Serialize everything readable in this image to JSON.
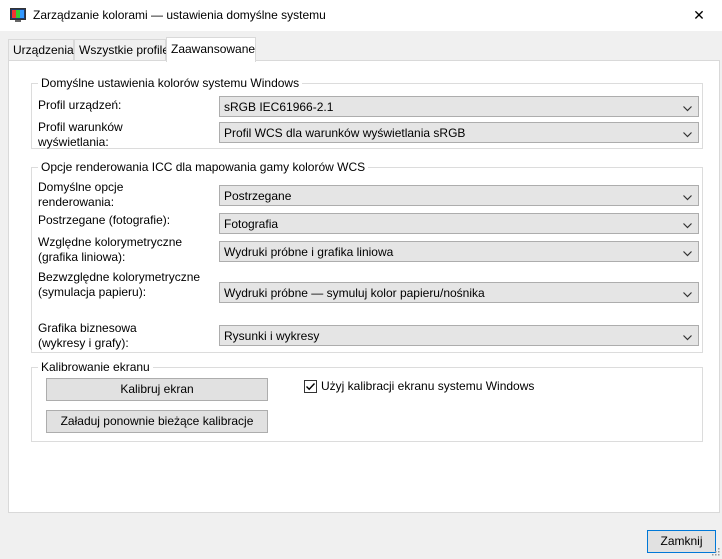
{
  "window": {
    "title": "Zarządzanie kolorami — ustawienia domyślne systemu",
    "close_glyph": "✕",
    "icon": "monitor-color-icon"
  },
  "tabs": [
    {
      "label": "Urządzenia",
      "active": false
    },
    {
      "label": "Wszystkie profile",
      "active": false
    },
    {
      "label": "Zaawansowane",
      "active": true
    }
  ],
  "windows_defaults": {
    "legend": "Domyślne ustawienia kolorów systemu Windows",
    "device_profile_label": "Profil urządzeń:",
    "device_profile_value": "sRGB IEC61966-2.1",
    "viewing_conditions_label": "Profil warunków wyświetlania:",
    "viewing_conditions_value": "Profil WCS dla warunków wyświetlania sRGB"
  },
  "icc_rendering": {
    "legend": "Opcje renderowania ICC dla mapowania gamy kolorów WCS",
    "rows": [
      {
        "label": "Domyślne opcje renderowania:",
        "value": "Postrzegane"
      },
      {
        "label": "Postrzegane (fotografie):",
        "value": "Fotografia"
      },
      {
        "label": "Względne kolorymetryczne (grafika liniowa):",
        "value": "Wydruki próbne i grafika liniowa"
      },
      {
        "label": "Bezwzględne kolorymetryczne (symulacja papieru):",
        "value": "Wydruki próbne — symuluj kolor papieru/nośnika"
      },
      {
        "label": "Grafika biznesowa (wykresy i grafy):",
        "value": "Rysunki i wykresy"
      }
    ]
  },
  "calibration": {
    "legend": "Kalibrowanie ekranu",
    "calibrate_button": "Kalibruj ekran",
    "reload_button": "Załaduj ponownie bieżące kalibracje",
    "use_windows_calibration_label": "Użyj kalibracji ekranu systemu Windows",
    "use_windows_calibration_checked": true
  },
  "footer": {
    "close_button": "Zamknij"
  },
  "colors": {
    "focus_border": "#0078d7",
    "combo_bg": "#e5e5e5",
    "panel_bg": "#ffffff",
    "window_bg": "#f0f0f0"
  }
}
